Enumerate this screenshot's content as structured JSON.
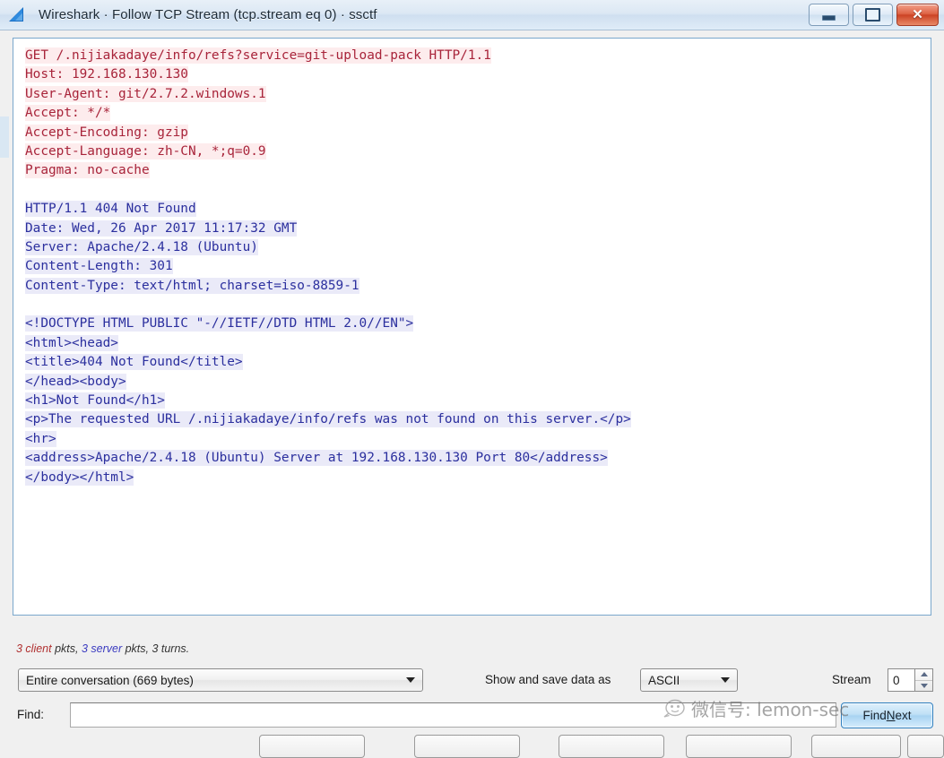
{
  "window": {
    "title": "Wireshark · Follow TCP Stream (tcp.stream eq 0) · ssctf",
    "logo_icon": "wireshark-shark-fin-icon",
    "buttons": {
      "minimize": "minimize-icon",
      "maximize": "maximize-icon",
      "close": "✕"
    }
  },
  "stream": {
    "lines": [
      {
        "side": "client",
        "text": "GET /.nijiakadaye/info/refs?service=git-upload-pack HTTP/1.1"
      },
      {
        "side": "client",
        "text": "Host: 192.168.130.130"
      },
      {
        "side": "client",
        "text": "User-Agent: git/2.7.2.windows.1"
      },
      {
        "side": "client",
        "text": "Accept: */*"
      },
      {
        "side": "client",
        "text": "Accept-Encoding: gzip"
      },
      {
        "side": "client",
        "text": "Accept-Language: zh-CN, *;q=0.9"
      },
      {
        "side": "client",
        "text": "Pragma: no-cache"
      },
      {
        "side": "blank",
        "text": ""
      },
      {
        "side": "server",
        "text": "HTTP/1.1 404 Not Found"
      },
      {
        "side": "server",
        "text": "Date: Wed, 26 Apr 2017 11:17:32 GMT"
      },
      {
        "side": "server",
        "text": "Server: Apache/2.4.18 (Ubuntu)"
      },
      {
        "side": "server",
        "text": "Content-Length: 301"
      },
      {
        "side": "server",
        "text": "Content-Type: text/html; charset=iso-8859-1"
      },
      {
        "side": "blank",
        "text": ""
      },
      {
        "side": "server",
        "text": "<!DOCTYPE HTML PUBLIC \"-//IETF//DTD HTML 2.0//EN\">"
      },
      {
        "side": "server",
        "text": "<html><head>"
      },
      {
        "side": "server",
        "text": "<title>404 Not Found</title>"
      },
      {
        "side": "server",
        "text": "</head><body>"
      },
      {
        "side": "server",
        "text": "<h1>Not Found</h1>"
      },
      {
        "side": "server",
        "text": "<p>The requested URL /.nijiakadaye/info/refs was not found on this server.</p>"
      },
      {
        "side": "server",
        "text": "<hr>"
      },
      {
        "side": "server",
        "text": "<address>Apache/2.4.18 (Ubuntu) Server at 192.168.130.130 Port 80</address>"
      },
      {
        "side": "server",
        "text": "</body></html>"
      }
    ],
    "colors": {
      "client_text": "#a8243a",
      "client_bg": "#fdeced",
      "server_text": "#2b2f9e",
      "server_bg": "#eaeaf8"
    }
  },
  "stats": {
    "client_count": "3 client",
    "client_suffix": " pkts, ",
    "server_count": "3 server",
    "server_suffix": " pkts, 3 turns."
  },
  "controls": {
    "conversation_value": "Entire conversation (669 bytes)",
    "conversation_caret": "chevron-down-icon",
    "data_as_label": "Show and save data as",
    "data_as_value": "ASCII",
    "data_as_caret": "chevron-down-icon",
    "stream_label": "Stream",
    "stream_value": "0",
    "spin_up": "spin-up-icon",
    "spin_down": "spin-down-icon"
  },
  "find": {
    "label": "Find:",
    "value": "",
    "placeholder": "",
    "button_prefix": "Find ",
    "button_accel": "N",
    "button_suffix": "ext"
  },
  "watermark": {
    "icon": "speech-bubble-face-icon",
    "text": "微信号: lemon-sec"
  },
  "bottom_buttons": [
    {
      "name": "bottom-button-1"
    },
    {
      "name": "bottom-button-2"
    },
    {
      "name": "bottom-button-3"
    },
    {
      "name": "bottom-button-4"
    },
    {
      "name": "bottom-button-5"
    },
    {
      "name": "bottom-button-6"
    }
  ]
}
